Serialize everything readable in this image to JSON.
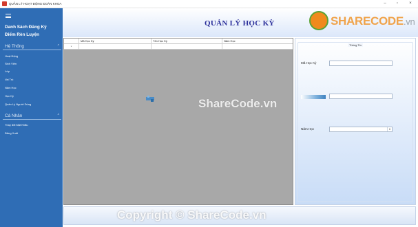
{
  "window": {
    "title": "QUẢN LÝ HOẠT ĐỘNG ĐOÀN KHOA",
    "controls": {
      "minimize": "–",
      "maximize": "▫",
      "close": "×"
    }
  },
  "sidebar": {
    "links": [
      "Danh Sách Đăng Ký",
      "Điểm Rèn Luyện"
    ],
    "sections": [
      {
        "label": "Hệ Thống",
        "items": [
          "Hoạt Động",
          "Sinh Viên",
          "Lớp",
          "Vai Trò",
          "Năm Học",
          "Học Kỳ",
          "Quản Lý Người Dùng"
        ]
      },
      {
        "label": "Cá Nhân",
        "items": [
          "Thay đổi Mật Khẩu",
          "Đăng Xuất"
        ]
      }
    ],
    "caret": "^"
  },
  "header": {
    "title": "QUẢN LÝ HỌC KỲ"
  },
  "watermark": {
    "logo_text": "SHARECODE",
    "logo_suffix": ".vn",
    "center_text": "ShareCode.vn",
    "bottom_text": "Copyright © ShareCode.vn"
  },
  "grid": {
    "columns": [
      "Mã Học Kỳ",
      "Tên Học Kỳ",
      "Năm Học"
    ],
    "new_row_marker": "*"
  },
  "info_panel": {
    "legend": "Thông Tin",
    "fields": {
      "semester_id_label": "Mã Học Kỳ",
      "semester_id_value": "",
      "semester_name_value": "",
      "school_year_label": "Năm Học",
      "school_year_value": ""
    },
    "dropdown_arrow": "▾"
  },
  "colors": {
    "sidebar": "#2f6db5",
    "title": "#2a2e9a",
    "grid_bg": "#a8a8a8",
    "brand_orange": "#f0a34a"
  }
}
